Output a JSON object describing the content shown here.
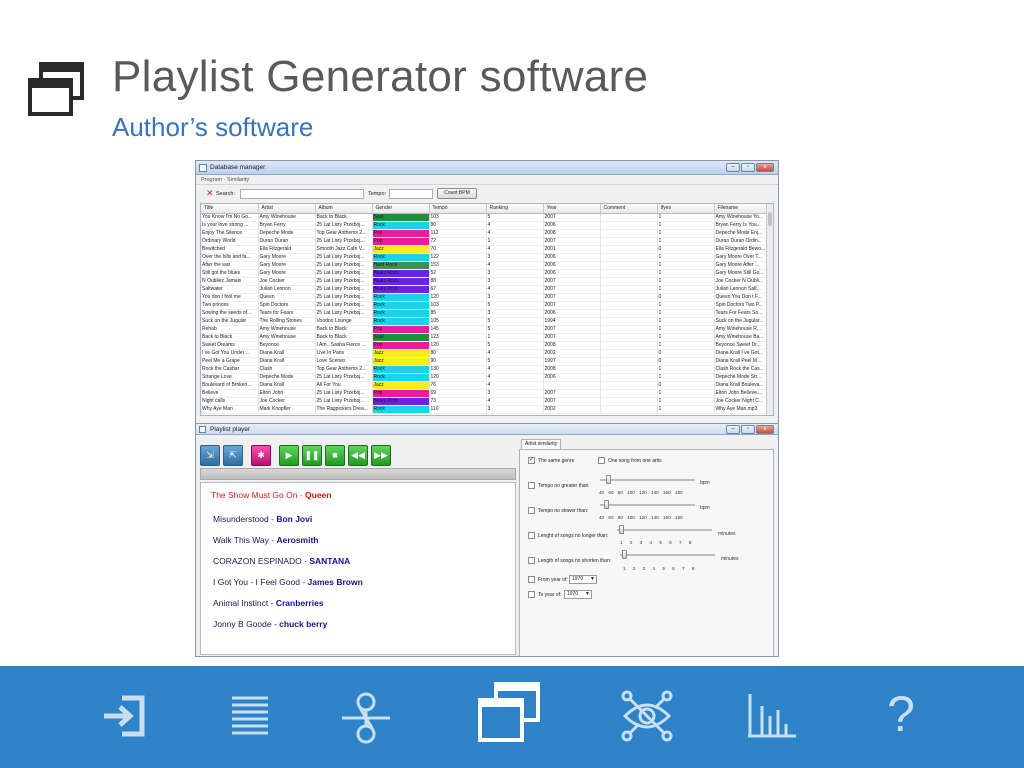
{
  "slide": {
    "title": "Playlist Generator software",
    "subtitle": "Author’s software"
  },
  "db_window": {
    "title": "Database manager",
    "tabs": "Program · Similarity",
    "search_label": "Search:",
    "tempo_label": "Tempo:",
    "count_button": "Count BPM",
    "columns": [
      "Title",
      "Artist",
      "Album",
      "Gender",
      "Tempo",
      "Ranking",
      "Year",
      "Comment",
      "Ifyes",
      "Filename"
    ],
    "rows": [
      [
        "You Know I'm No Go...",
        "Amy Winehouse",
        "Back to Black",
        "Soul",
        "103",
        "5",
        "2007",
        "",
        "1",
        "Amy Winehouse  Yo..."
      ],
      [
        "Is your love strong ...",
        "Bryan Ferry",
        "25 Lat Listy Przeboj...",
        "Rock",
        "80",
        "4",
        "2006",
        "",
        "1",
        "Bryan Ferry  Is You..."
      ],
      [
        "Enjoy The Silence",
        "Depeche Mode",
        "Top Gear Anthems 2...",
        "Pop",
        "112",
        "4",
        "2008",
        "",
        "1",
        "Depeche Mode  Enj..."
      ],
      [
        "Ordinary World",
        "Duran Duran",
        "25 Lat Listy Przeboj...",
        "Pop",
        "72",
        "1",
        "2007",
        "",
        "1",
        "Duran Duran  Ordin..."
      ],
      [
        "Bewitched",
        "Ella Fitzgerald",
        "Smooth Jazz Cafe V...",
        "Jazz",
        "70",
        "4",
        "2001",
        "",
        "0",
        "Ella Fitzgerald  Bewo..."
      ],
      [
        "Over the hills and fa...",
        "Gary Moore",
        "25 Lat Listy Przeboj...",
        "Rock",
        "122",
        "3",
        "2006",
        "",
        "1",
        "Gary Moore  Over T..."
      ],
      [
        "After the war",
        "Gary Moore",
        "25 Lat Listy Przeboj...",
        "Hard Rock",
        "153",
        "4",
        "2006",
        "",
        "1",
        "Gary Moore  After ..."
      ],
      [
        "Still got the blues",
        "Gary Moore",
        "25 Lat Listy Przeboj...",
        "Blues Rock",
        "52",
        "3",
        "2006",
        "",
        "1",
        "Gary Moore  Still Go..."
      ],
      [
        "N Oubliez Jamais",
        "Joe Cocker",
        "25 Lat Listy Przeboj...",
        "Blues Rock",
        "88",
        "3",
        "2007",
        "",
        "1",
        "Joe Cocker  N Oubli..."
      ],
      [
        "Saltwater",
        "Julian Lennon",
        "25 Lat Listy Przeboj...",
        "Blues Rock",
        "67",
        "4",
        "2007",
        "",
        "1",
        "Julian Lennon  Salt..."
      ],
      [
        "You don t fool me",
        "Queen",
        "25 Lat Listy Przeboj...",
        "Rock",
        "120",
        "3",
        "2007",
        "",
        "0",
        "Queen  You Don t F..."
      ],
      [
        "Two princes",
        "Spin Doctors",
        "25 Lat Listy Przeboj...",
        "Rock",
        "103",
        "5",
        "2007",
        "",
        "1",
        "Spin Doctors  Two P..."
      ],
      [
        "Sowing the seeds of...",
        "Tears for Fears",
        "25 Lat Listy Przeboj...",
        "Rock",
        "85",
        "3",
        "2006",
        "",
        "1",
        "Tears For Fears  So..."
      ],
      [
        "Suck on the Jugular",
        "The Rolling Stones",
        "Voodoo Lounge",
        "Rock",
        "105",
        "5",
        "1994",
        "",
        "1",
        "Suck on the Jugular..."
      ],
      [
        "Rehab",
        "Amy Winehouse",
        "Back to Black",
        "Pop",
        "145",
        "5",
        "2007",
        "",
        "1",
        "Amy Winehouse  R..."
      ],
      [
        "Back to Black",
        "Amy Winehouse",
        "Back to Black",
        "Soul",
        "123",
        "1",
        "2007",
        "",
        "1",
        "Amy Winehouse  Ba..."
      ],
      [
        "Sweet Dreams",
        "Beyonce",
        "I Am...Sasha Fierce ...",
        "Pop",
        "120",
        "5",
        "2008",
        "",
        "1",
        "Beyonce  Sweet Dr..."
      ],
      [
        "I ve Got You Under ...",
        "Diana Krall",
        "Live In Paris",
        "Jazz",
        "80",
        "4",
        "2002",
        "",
        "0",
        "Diana Krall  I ve Got..."
      ],
      [
        "Peel Me a Grape",
        "Diana Krall",
        "Love Scenes",
        "Jazz",
        "90",
        "5",
        "1997",
        "",
        "0",
        "Diana Krall  Peel M..."
      ],
      [
        "Rock the Casbar",
        "Clash",
        "Top Gear Anthems 2...",
        "Rock",
        "130",
        "4",
        "2008",
        "",
        "1",
        "Clash  Rock the Cas..."
      ],
      [
        "Strange Love",
        "Depeche Mode",
        "25 Lat Listy Przeboj...",
        "Rock",
        "120",
        "4",
        "2006",
        "",
        "1",
        "Depeche Mode  Str..."
      ],
      [
        "Boulevard of Broken...",
        "Diana Krall",
        "All For You",
        "Jazz",
        "76",
        "4",
        "",
        "",
        "0",
        "Diana Krall  Bouleva..."
      ],
      [
        "Believe",
        "Elton John",
        "25 Lat Listy Przeboj...",
        "Pop",
        "69",
        "3",
        "2007",
        "",
        "1",
        "Elton John  Believe...."
      ],
      [
        "Night calls",
        "Joe Cocker",
        "25 Lat Listy Przeboj...",
        "Blues Rock",
        "73",
        "4",
        "2007",
        "",
        "1",
        "Joe Cocker  Night C..."
      ],
      [
        "Why Aye Man",
        "Mark Knopfler",
        "The Ragpickers Drea...",
        "Rock",
        "110",
        "3",
        "2002",
        "",
        "1",
        "Why Aye Man.mp3"
      ]
    ],
    "gender_colors": {
      "Soul": "#1f8f3a",
      "Rock": "#19d3e6",
      "Pop": "#ee1b9b",
      "Jazz": "#f2ee22",
      "Hard Rock": "#3f8f5e",
      "Blues Rock": "#6b24e6"
    }
  },
  "player": {
    "title": "Playlist player",
    "now_playing": {
      "song": "The Show Must Go On - ",
      "artist": "Queen"
    },
    "playlist": [
      {
        "song": "Misunderstood - ",
        "artist": "Bon Jovi"
      },
      {
        "song": "Walk This Way - ",
        "artist": "Aerosmith"
      },
      {
        "song": "CORAZON ESPINADO - ",
        "artist": "SANTANA"
      },
      {
        "song": "I Got You - I Feel Good - ",
        "artist": "James Brown"
      },
      {
        "song": "Animal Instinct - ",
        "artist": "Cranberries"
      },
      {
        "song": "Jonny B Goode - ",
        "artist": "chuck berry"
      }
    ],
    "similarity": {
      "tab": "Artist similarity",
      "same_genre": "The same genre",
      "one_song": "One song from one artis",
      "tempo_greater": "Tempo no greater than:",
      "tempo_slower": "Tempo no slower than:",
      "tempo_ticks": "40  60  80  100  120  140  160  180",
      "bpm": "bpm",
      "length_longer": "Lenght of songs no longer than:",
      "length_shorter": "Length of songs no shorten than:",
      "minute_ticks": "1  2  3  4  5  6  7  8",
      "minutes": "minutes",
      "from_year": "From year of:",
      "to_year": "To year of:",
      "from_year_value": "1970",
      "to_year_value": "1970"
    }
  },
  "nav": {
    "help_glyph": "?",
    "icons": [
      "enter-icon",
      "list-icon",
      "node-icon",
      "windows-icon",
      "eye-network-icon",
      "bar-chart-icon",
      "help-icon"
    ]
  }
}
